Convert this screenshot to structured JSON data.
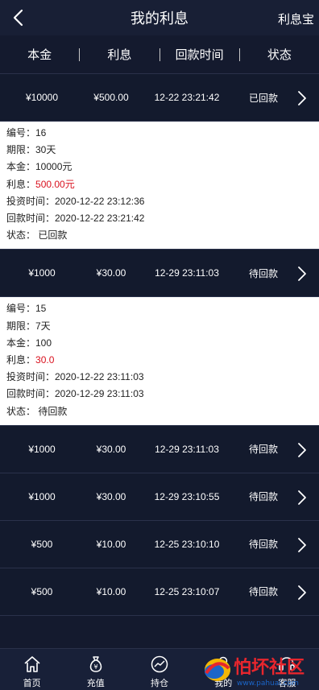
{
  "header": {
    "title": "我的利息",
    "right_label": "利息宝"
  },
  "columns": [
    "本金",
    "利息",
    "回款时间",
    "状态"
  ],
  "records": [
    {
      "principal": "¥10000",
      "interest": "¥500.00",
      "time": "12-22 23:21:42",
      "status": "已回款",
      "expanded": true,
      "detail": [
        {
          "text": "编号：16"
        },
        {
          "text": "期限：30天"
        },
        {
          "text": "本金：10000元"
        },
        {
          "label": "利息：",
          "value": "500.00元"
        },
        {
          "text": "投资时间：2020-12-22 23:12:36"
        },
        {
          "text": "回款时间：2020-12-22 23:21:42"
        },
        {
          "text": "状态：  已回款"
        }
      ]
    },
    {
      "principal": "¥1000",
      "interest": "¥30.00",
      "time": "12-29 23:11:03",
      "status": "待回款",
      "expanded": true,
      "detail": [
        {
          "text": "编号：15"
        },
        {
          "text": "期限：7天"
        },
        {
          "text": "本金：100"
        },
        {
          "label": "利息：",
          "value": "30.0"
        },
        {
          "text": "投资时间：2020-12-22 23:11:03"
        },
        {
          "text": "回款时间：2020-12-29 23:11:03"
        },
        {
          "text": "状态：  待回款"
        }
      ]
    },
    {
      "principal": "¥1000",
      "interest": "¥30.00",
      "time": "12-29 23:11:03",
      "status": "待回款",
      "expanded": false
    },
    {
      "principal": "¥1000",
      "interest": "¥30.00",
      "time": "12-29 23:10:55",
      "status": "待回款",
      "expanded": false
    },
    {
      "principal": "¥500",
      "interest": "¥10.00",
      "time": "12-25 23:10:10",
      "status": "待回款",
      "expanded": false
    },
    {
      "principal": "¥500",
      "interest": "¥10.00",
      "time": "12-25 23:10:07",
      "status": "待回款",
      "expanded": false
    }
  ],
  "tabbar": [
    {
      "label": "首页",
      "icon": "home-icon"
    },
    {
      "label": "充值",
      "icon": "money-bag-icon"
    },
    {
      "label": "持仓",
      "icon": "chart-icon"
    },
    {
      "label": "我的",
      "icon": "user-icon"
    },
    {
      "label": "客服",
      "icon": "headset-icon"
    }
  ],
  "watermark": {
    "text": "怕坏社区",
    "subtext": "www.pahuai.com"
  }
}
